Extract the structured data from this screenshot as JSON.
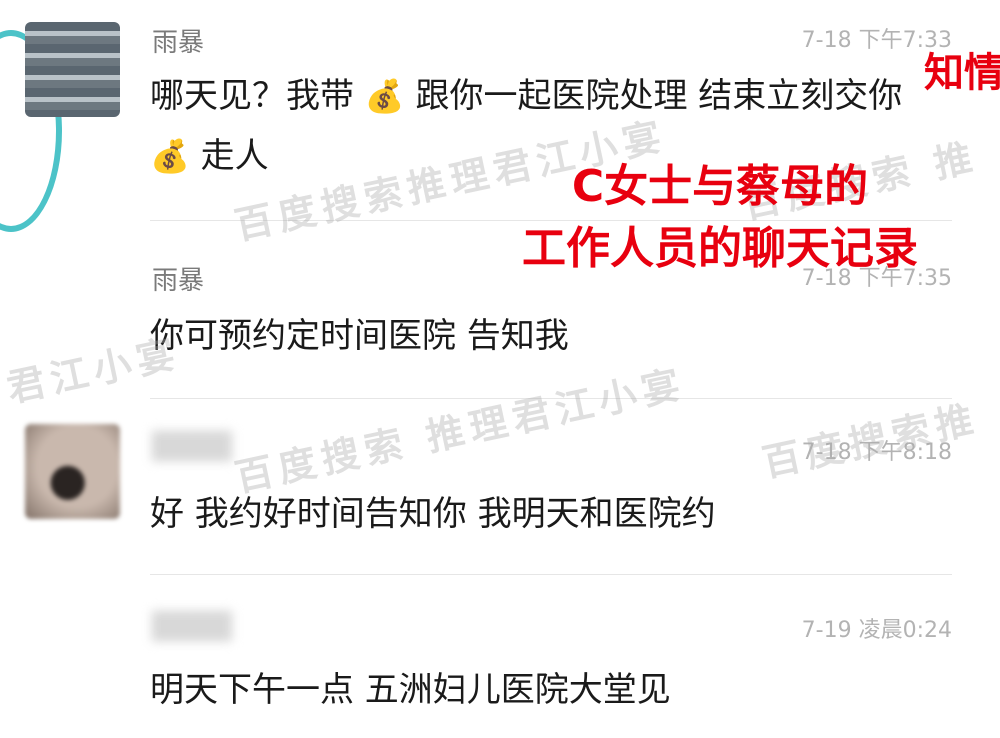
{
  "overlay": {
    "caption_line1": "C女士与蔡母的",
    "caption_line2": "工作人员的聊天记录",
    "corner_text": "知情"
  },
  "watermarks": [
    "百度搜索推理君江小宴",
    "百度搜索 推理君江小宴",
    "君江小宴",
    "百度搜索推理君江小宴",
    "百度搜索 推",
    "百度搜索推"
  ],
  "messages": [
    {
      "sender": "雨暴",
      "time": "7-18 下午7:33",
      "text_parts": [
        "哪天见？我带",
        "跟你一起医院处理 结束立刻交你",
        "走人"
      ],
      "icon": "money-bag-icon"
    },
    {
      "sender": "雨暴",
      "time": "7-18 下午7:35",
      "text": "你可预约定时间医院 告知我"
    },
    {
      "sender": "",
      "time": "7-18 下午8:18",
      "text": "好 我约好时间告知你 我明天和医院约"
    },
    {
      "sender": "",
      "time": "7-19 凌晨0:24",
      "text": "明天下午一点 五洲妇儿医院大堂见"
    }
  ]
}
